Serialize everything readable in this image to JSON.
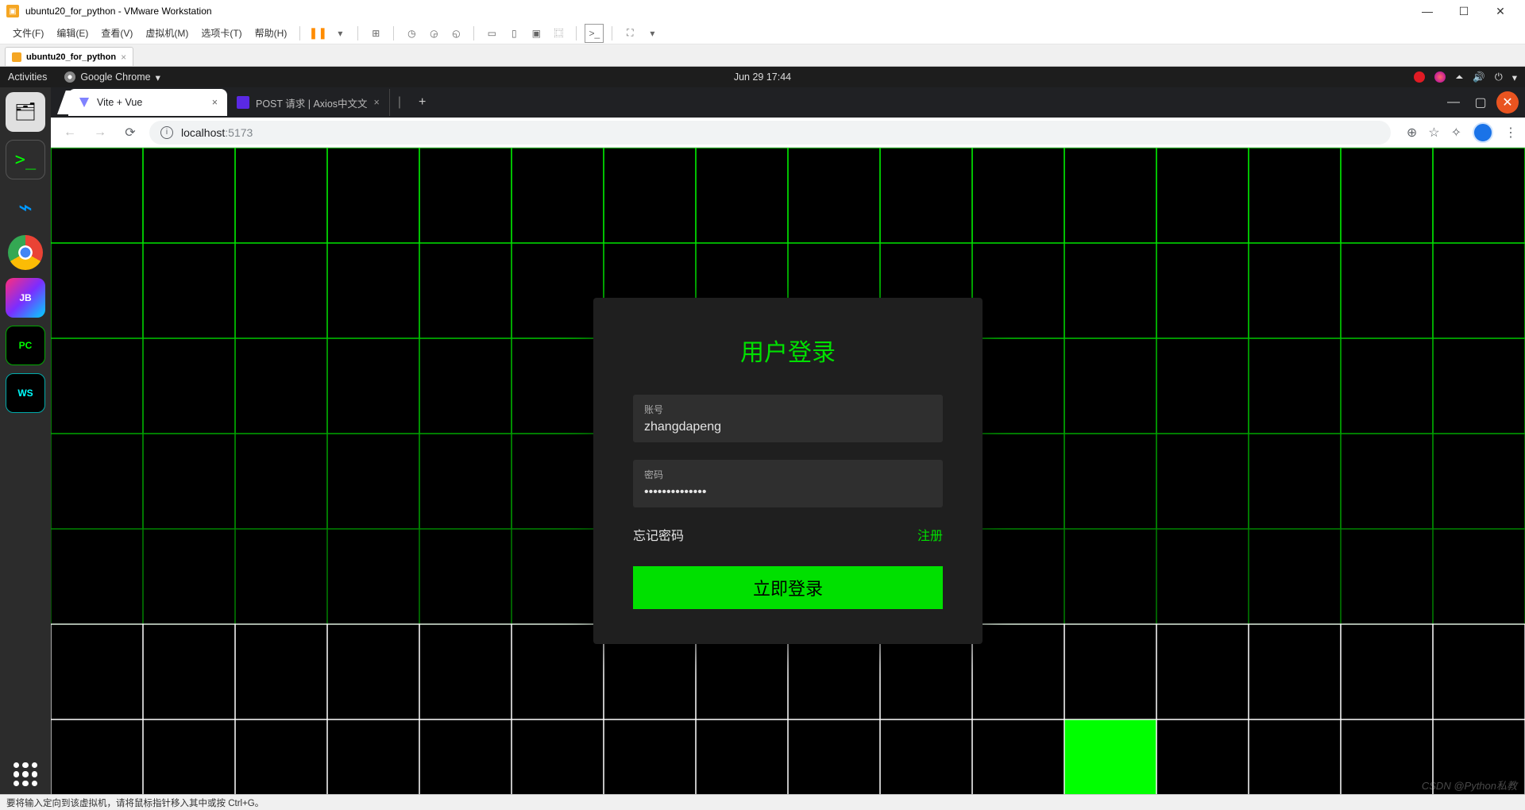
{
  "vmware": {
    "title": "ubuntu20_for_python - VMware Workstation",
    "menu": {
      "file": "文件(F)",
      "edit": "编辑(E)",
      "view": "查看(V)",
      "vm": "虚拟机(M)",
      "tabs": "选项卡(T)",
      "help": "帮助(H)"
    },
    "tab_label": "ubuntu20_for_python",
    "status": "要将输入定向到该虚拟机，请将鼠标指针移入其中或按 Ctrl+G。"
  },
  "ubuntu": {
    "activities": "Activities",
    "app_menu": "Google Chrome",
    "clock": "Jun 29  17:44"
  },
  "chrome": {
    "tab1": "Vite + Vue",
    "tab2": "POST 请求 | Axios中文文",
    "url_host": "localhost",
    "url_port": ":5173"
  },
  "login": {
    "title": "用户登录",
    "user_label": "账号",
    "user_value": "zhangdapeng",
    "pass_label": "密码",
    "pass_value": "••••••••••••••",
    "forgot": "忘记密码",
    "register": "注册",
    "submit": "立即登录"
  },
  "watermark": "CSDN @Python私教"
}
